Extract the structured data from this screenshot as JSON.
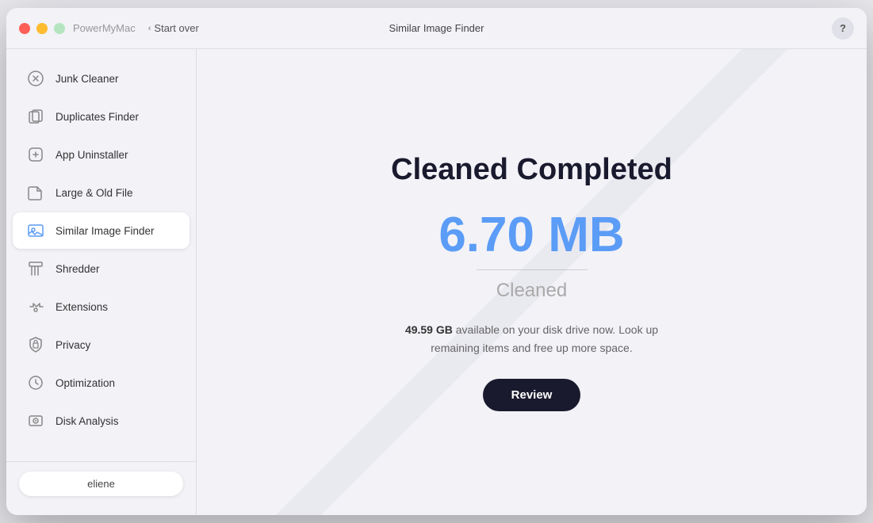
{
  "titleBar": {
    "appName": "PowerMyMac",
    "startOver": "Start over",
    "centerTitle": "Similar Image Finder",
    "helpLabel": "?"
  },
  "sidebar": {
    "items": [
      {
        "id": "junk-cleaner",
        "label": "Junk Cleaner",
        "active": false
      },
      {
        "id": "duplicates-finder",
        "label": "Duplicates Finder",
        "active": false
      },
      {
        "id": "app-uninstaller",
        "label": "App Uninstaller",
        "active": false
      },
      {
        "id": "large-old-file",
        "label": "Large & Old File",
        "active": false
      },
      {
        "id": "similar-image-finder",
        "label": "Similar Image Finder",
        "active": true
      },
      {
        "id": "shredder",
        "label": "Shredder",
        "active": false
      },
      {
        "id": "extensions",
        "label": "Extensions",
        "active": false
      },
      {
        "id": "privacy",
        "label": "Privacy",
        "active": false
      },
      {
        "id": "optimization",
        "label": "Optimization",
        "active": false
      },
      {
        "id": "disk-analysis",
        "label": "Disk Analysis",
        "active": false
      }
    ],
    "user": "eliene"
  },
  "content": {
    "heading": "Cleaned Completed",
    "cleanedAmount": "6.70 MB",
    "cleanedLabel": "Cleaned",
    "availableGB": "49.59 GB",
    "availableText": " available on your disk drive now. Look up remaining items and free up more space.",
    "reviewButton": "Review"
  }
}
